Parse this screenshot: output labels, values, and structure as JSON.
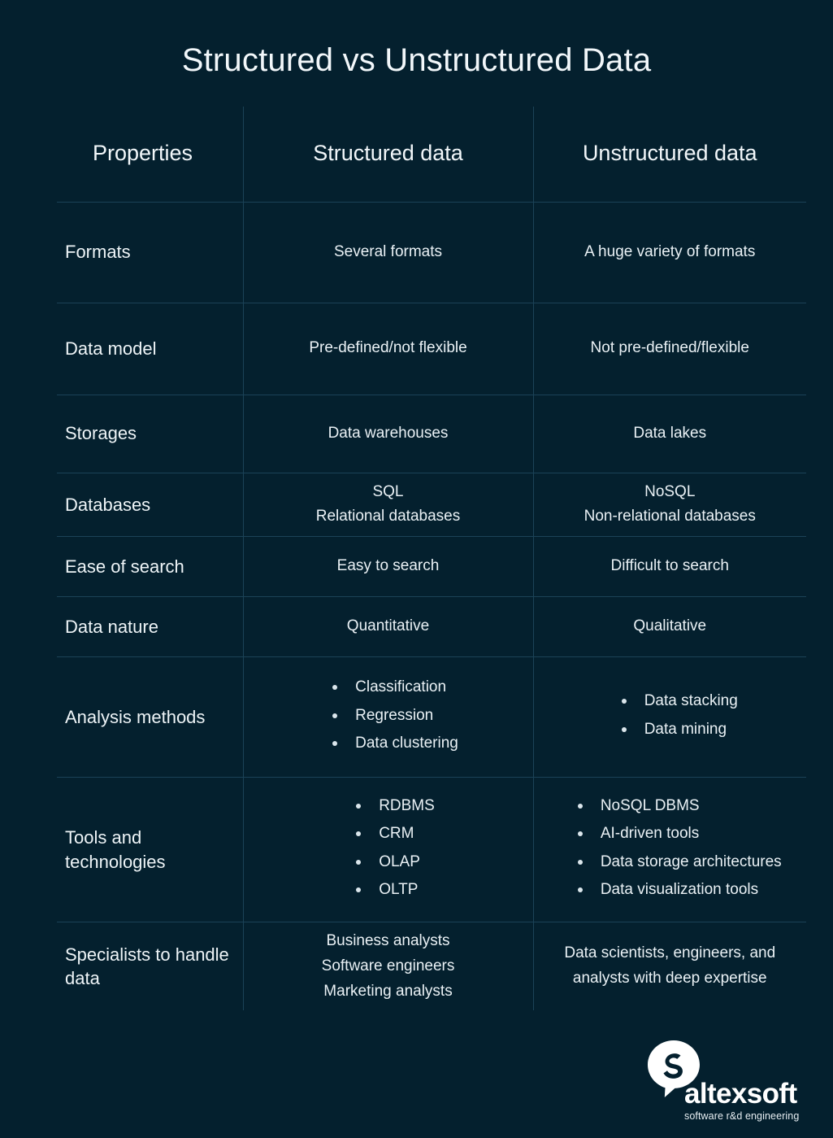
{
  "page": {
    "title": "Structured vs Unstructured Data",
    "background_color": "#04202e",
    "text_color": "#eef4f7",
    "divider_color": "#1b4257"
  },
  "table": {
    "headers": {
      "properties": "Properties",
      "structured": "Structured data",
      "unstructured": "Unstructured data"
    },
    "rows": [
      {
        "property": "Formats",
        "structured": "Several formats",
        "unstructured": "A huge variety of formats"
      },
      {
        "property": "Data model",
        "structured": "Pre-defined/not flexible",
        "unstructured": "Not pre-defined/flexible"
      },
      {
        "property": "Storages",
        "structured": "Data warehouses",
        "unstructured": "Data lakes"
      },
      {
        "property": "Databases",
        "structured_lines": [
          "SQL",
          "Relational databases"
        ],
        "unstructured_lines": [
          "NoSQL",
          "Non-relational databases"
        ]
      },
      {
        "property": "Ease of search",
        "structured": "Easy to search",
        "unstructured": "Difficult to search"
      },
      {
        "property": "Data nature",
        "structured": "Quantitative",
        "unstructured": "Qualitative"
      },
      {
        "property": "Analysis methods",
        "structured_bullets": [
          "Classification",
          "Regression",
          "Data clustering"
        ],
        "unstructured_bullets": [
          "Data stacking",
          "Data mining"
        ]
      },
      {
        "property": "Tools and technologies",
        "structured_bullets": [
          "RDBMS",
          "CRM",
          "OLAP",
          "OLTP"
        ],
        "unstructured_bullets": [
          "NoSQL DBMS",
          "AI-driven tools",
          "Data storage architectures",
          "Data visualization tools"
        ]
      },
      {
        "property": "Specialists to handle data",
        "structured_lines": [
          "Business analysts",
          "Software engineers",
          "Marketing analysts"
        ],
        "unstructured_lines": [
          "Data scientists, engineers, and",
          "analysts with deep expertise"
        ]
      }
    ]
  },
  "logo": {
    "mark": "altexsoft-speech-bubble-a-mark",
    "wordmark": "altexsoft",
    "tagline": "software r&d engineering"
  }
}
